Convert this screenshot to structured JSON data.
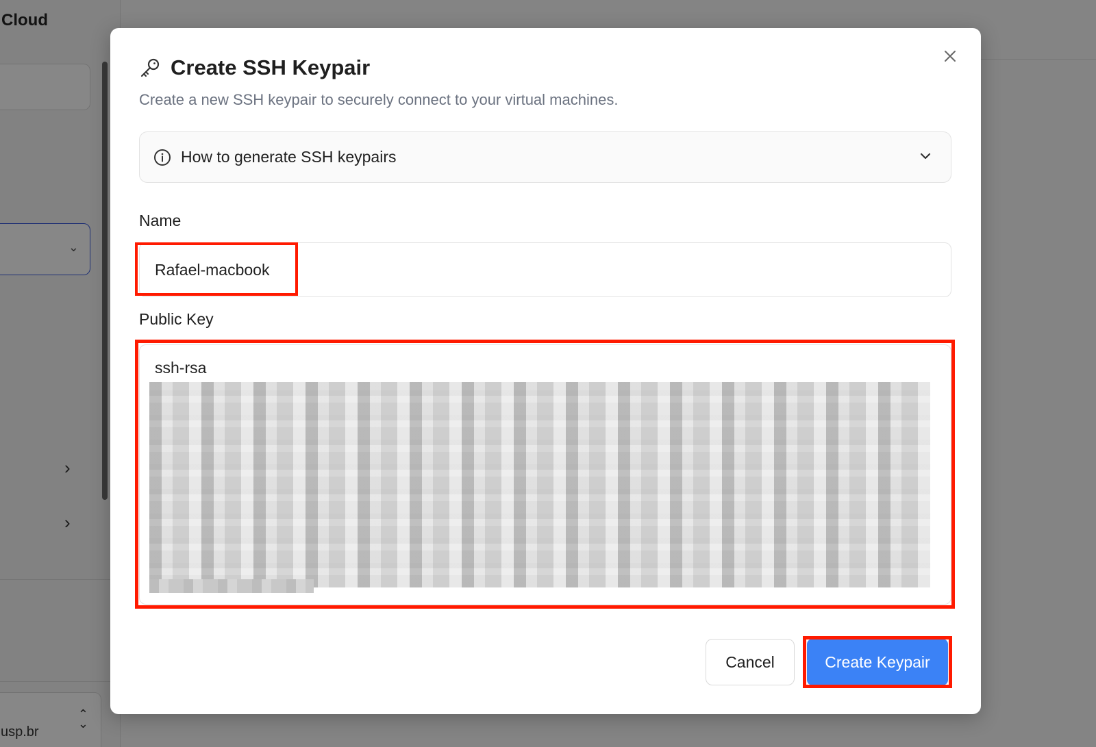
{
  "app": {
    "brand": "Cloud",
    "user_email_fragment": "usp.br"
  },
  "modal": {
    "title": "Create SSH Keypair",
    "subtitle": "Create a new SSH keypair to securely connect to your virtual machines.",
    "accordion_label": "How to generate SSH keypairs",
    "name_label": "Name",
    "name_value": "Rafael-macbook",
    "public_key_label": "Public Key",
    "public_key_prefix": "ssh-rsa",
    "cancel_label": "Cancel",
    "create_label": "Create Keypair"
  },
  "colors": {
    "primary": "#3b82f6",
    "highlight": "#ff1a00",
    "overlay": "#000000"
  },
  "icons": {
    "title": "key-icon",
    "close": "close-icon",
    "accordion_info": "info-icon",
    "accordion_toggle": "chevron-down-icon"
  }
}
